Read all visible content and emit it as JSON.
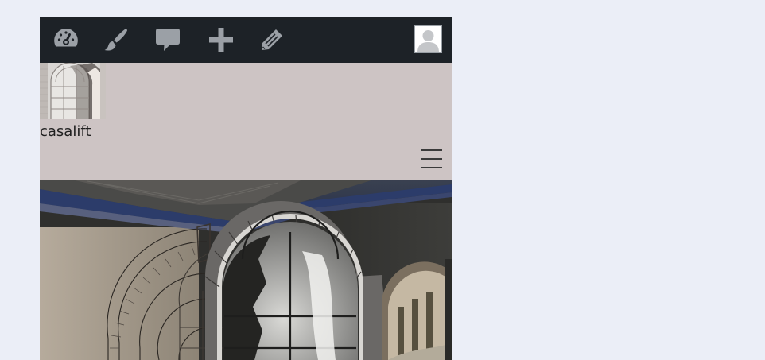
{
  "colors": {
    "page_background": "#ebeef7",
    "admin_bar": "#1d2227",
    "admin_icon": "#9ba0a6",
    "header_background": "#cdc4c4",
    "site_title_text": "#1f1f1f"
  },
  "admin_bar": {
    "items": [
      {
        "icon": "dashboard-gauge-icon"
      },
      {
        "icon": "customize-brush-icon"
      },
      {
        "icon": "comments-bubble-icon"
      },
      {
        "icon": "new-plus-icon"
      },
      {
        "icon": "edit-pencil-icon"
      }
    ],
    "account_icon": "user-avatar-icon"
  },
  "header": {
    "site_title": "casalift",
    "logo_icon": "window-arch-logo",
    "menu_icon": "hamburger-menu-icon"
  },
  "hero": {
    "image": "arched-window-interior-image"
  }
}
